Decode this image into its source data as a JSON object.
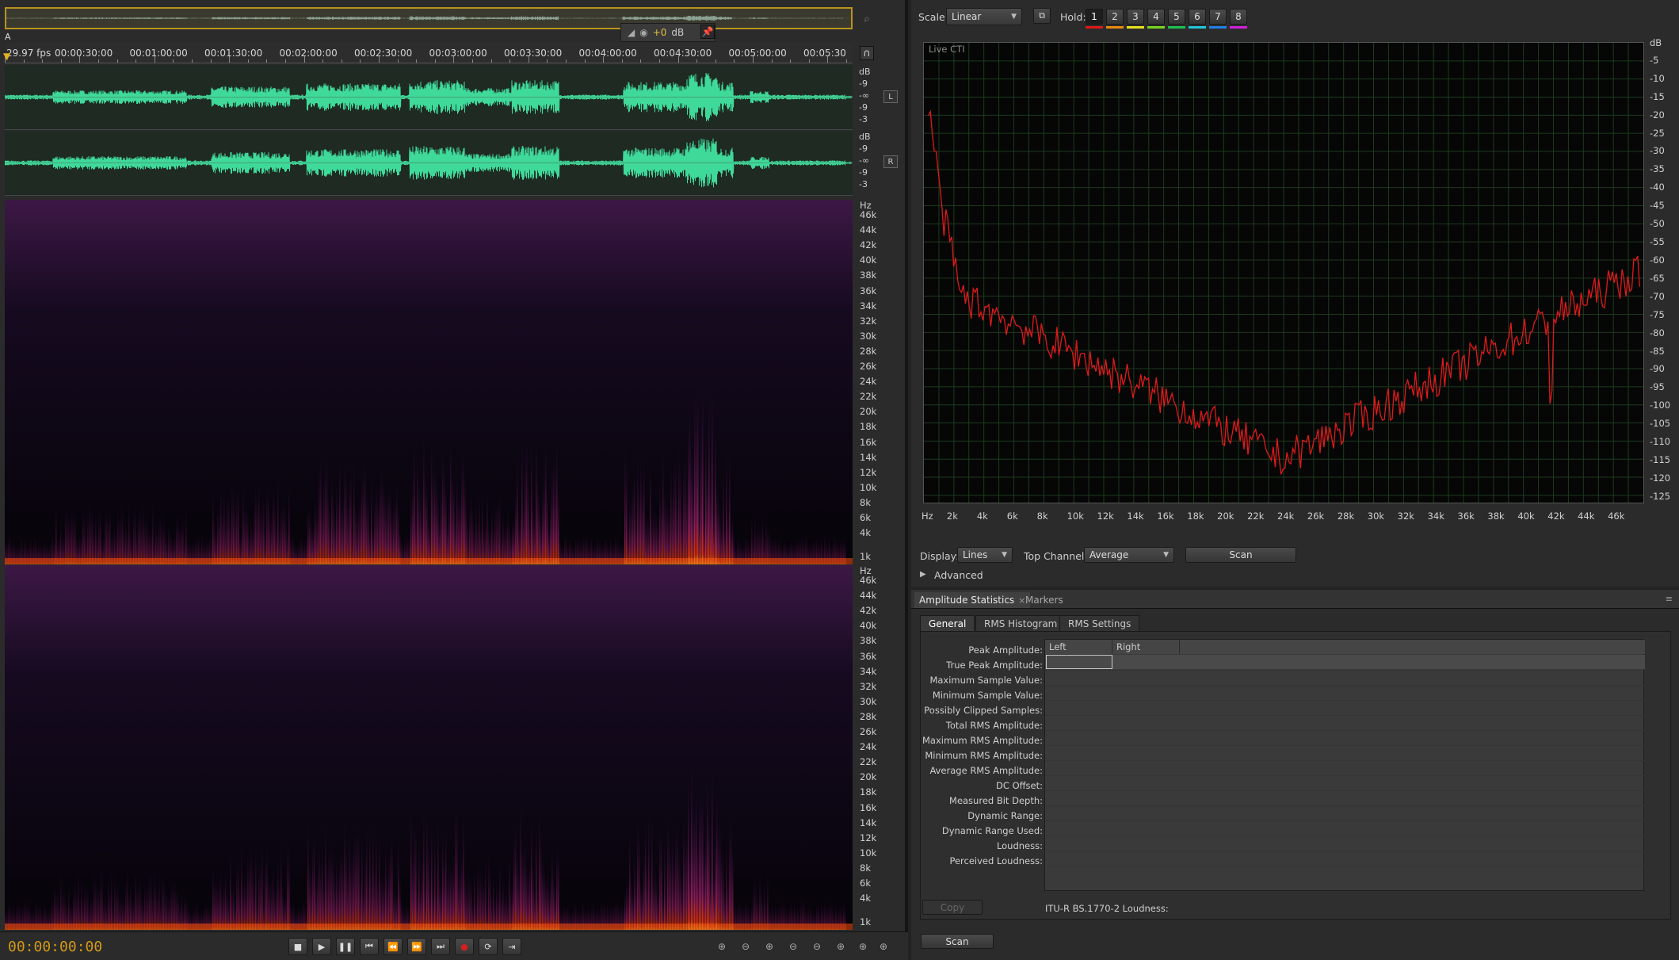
{
  "editor": {
    "level_value": "+0",
    "level_unit": "dB",
    "marker_label": "A",
    "fps_label": "29.97 fps",
    "ruler_labels": [
      "00:00:30:00",
      "00:01:00:00",
      "00:01:30:00",
      "00:02:00:00",
      "00:02:30:00",
      "00:03:00:00",
      "00:03:30:00",
      "00:04:00:00",
      "00:04:30:00",
      "00:05:00:00",
      "00:05:30"
    ],
    "db_scale_left": [
      "dB",
      "-9",
      "-∞",
      "-9",
      "-3"
    ],
    "db_scale_right": [
      "dB",
      "-9",
      "-∞",
      "-9",
      "-3"
    ],
    "channel_left": "L",
    "channel_right": "R",
    "hz_scale": [
      "Hz",
      "46k",
      "44k",
      "42k",
      "40k",
      "38k",
      "36k",
      "34k",
      "32k",
      "30k",
      "28k",
      "26k",
      "24k",
      "22k",
      "20k",
      "18k",
      "16k",
      "14k",
      "12k",
      "10k",
      "8k",
      "6k",
      "4k",
      "1k"
    ],
    "time_display": "00:00:00:00",
    "wave_color": "#3fd99a"
  },
  "frequency": {
    "scale_label": "Scale:",
    "scale_value": "Linear",
    "hold_label": "Hold:",
    "hold_buttons": [
      "1",
      "2",
      "3",
      "4",
      "5",
      "6",
      "7",
      "8"
    ],
    "hold_colors": [
      "#e01818",
      "#e88a10",
      "#e8e020",
      "#7ad420",
      "#20c050",
      "#20c8d8",
      "#2080e8",
      "#d020d8"
    ],
    "graph_label": "Live CTI",
    "line_color": "#e01a1a",
    "y_labels": [
      "dB",
      "-5",
      "-10",
      "-15",
      "-20",
      "-25",
      "-30",
      "-35",
      "-40",
      "-45",
      "-50",
      "-55",
      "-60",
      "-65",
      "-70",
      "-75",
      "-80",
      "-85",
      "-90",
      "-95",
      "-100",
      "-105",
      "-110",
      "-115",
      "-120",
      "-125"
    ],
    "x_labels": [
      "Hz",
      "2k",
      "4k",
      "6k",
      "8k",
      "10k",
      "12k",
      "14k",
      "16k",
      "18k",
      "20k",
      "22k",
      "24k",
      "26k",
      "28k",
      "30k",
      "32k",
      "34k",
      "36k",
      "38k",
      "40k",
      "42k",
      "44k",
      "46k"
    ],
    "display_label": "Display:",
    "display_value": "Lines",
    "top_channel_label": "Top Channel:",
    "top_channel_value": "Average",
    "scan_label": "Scan",
    "advanced_label": "Advanced"
  },
  "amplitude": {
    "tab_title": "Amplitude Statistics",
    "tab_close": "×",
    "tab_markers": "Markers",
    "subtabs": [
      "General",
      "RMS Histogram",
      "RMS Settings"
    ],
    "columns": [
      "Left",
      "Right"
    ],
    "rows": [
      "Peak Amplitude:",
      "True Peak Amplitude:",
      "Maximum Sample Value:",
      "Minimum Sample Value:",
      "Possibly Clipped Samples:",
      "Total RMS Amplitude:",
      "Maximum RMS Amplitude:",
      "Minimum RMS Amplitude:",
      "Average RMS Amplitude:",
      "DC Offset:",
      "Measured Bit Depth:",
      "Dynamic Range:",
      "Dynamic Range Used:",
      "Loudness:",
      "Perceived Loudness:"
    ],
    "copy_label": "Copy",
    "itu_label": "ITU-R BS.1770-2 Loudness:",
    "scan_label": "Scan"
  }
}
